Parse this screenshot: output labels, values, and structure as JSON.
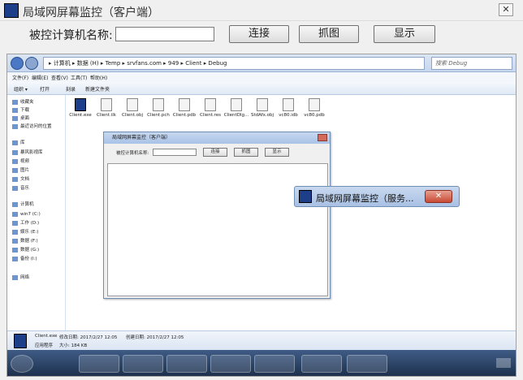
{
  "window": {
    "title": "局域网屏幕监控（客户端）",
    "close_glyph": "✕"
  },
  "form": {
    "label": "被控计算机名称:",
    "input_value": "",
    "buttons": {
      "connect": "连接",
      "capture": "抓图",
      "show": "显示"
    }
  },
  "screenshot": {
    "address": "▸ 计算机 ▸ 数据 (H) ▸ Temp ▸ srvfans.com ▸ 949 ▸ Client ▸ Debug",
    "search_placeholder": "搜索 Debug",
    "menu": [
      "文件(F)",
      "编辑(E)",
      "查看(V)",
      "工具(T)",
      "帮助(H)"
    ],
    "commands": [
      "组织 ▾",
      "打开",
      "刻录",
      "新建文件夹"
    ],
    "nav": [
      "收藏夹",
      "下载",
      "桌面",
      "最近访问的位置",
      "库",
      "暴风影视库",
      "视频",
      "图片",
      "文档",
      "音乐",
      "计算机",
      "win7 (C:)",
      "工作 (D:)",
      "娱乐 (E:)",
      "数据 (F:)",
      "数据 (G:)",
      "备份 (I:)",
      "网络"
    ],
    "files": [
      "Client.exe",
      "Client.ilk",
      "Client.obj",
      "Client.pch",
      "Client.pdb",
      "Client.res",
      "ClientDlg...",
      "StdAfx.obj",
      "vc80.idb",
      "vc80.pdb"
    ],
    "details": {
      "name": "Client.exe",
      "modified": "修改日期: 2017/2/27 12:05",
      "created": "创建日期: 2017/2/27 12:05",
      "type": "应用程序",
      "size": "大小: 184 KB"
    },
    "mini_window": {
      "title": "局域网屏幕监控（客户端）",
      "label": "被控计算机名称:",
      "connect": "连接",
      "capture": "抓图",
      "show": "显示"
    },
    "server_window": {
      "title": "局域网屏幕监控（服务...",
      "close_glyph": "✕"
    }
  }
}
